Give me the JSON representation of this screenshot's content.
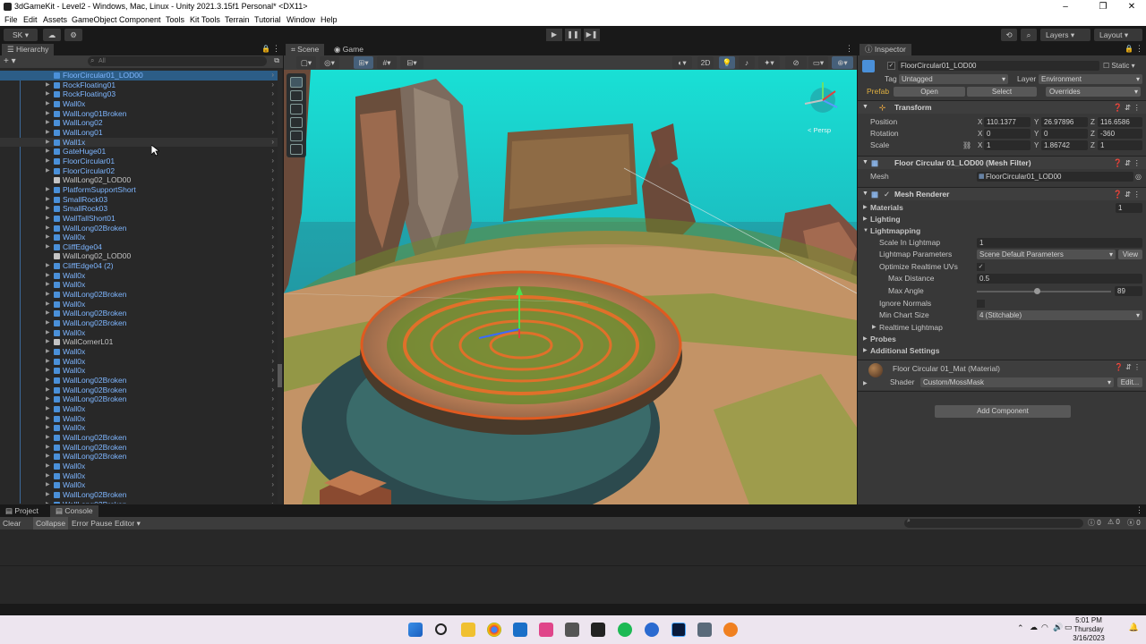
{
  "window": {
    "title": "3dGameKit - Level2 - Windows, Mac, Linux - Unity 2021.3.15f1 Personal* <DX11>",
    "minimize": "–",
    "maximize": "❐",
    "close": "✕"
  },
  "menu": [
    "File",
    "Edit",
    "Assets",
    "GameObject",
    "Component",
    "Tools",
    "Kit Tools",
    "Terrain",
    "Tutorial",
    "Window",
    "Help"
  ],
  "toolbar": {
    "account": "SK ▾",
    "play": "▶",
    "pause": "❚❚",
    "step": "▶❚",
    "layers": "Layers",
    "layout": "Layout"
  },
  "hierarchy": {
    "tab": "Hierarchy",
    "search_placeholder": "All",
    "items": [
      {
        "label": "FloorCircular01_LOD00",
        "color": "blue",
        "arrow": false,
        "selected": true
      },
      {
        "label": "RockFloating01",
        "color": "blue",
        "arrow": true
      },
      {
        "label": "RockFloating03",
        "color": "blue",
        "arrow": true
      },
      {
        "label": "Wall0x",
        "color": "blue",
        "arrow": true
      },
      {
        "label": "WallLong01Broken",
        "color": "blue",
        "arrow": true
      },
      {
        "label": "WallLong02",
        "color": "blue",
        "arrow": true
      },
      {
        "label": "WallLong01",
        "color": "blue",
        "arrow": true
      },
      {
        "label": "Wall1x",
        "color": "blue",
        "arrow": true,
        "hover": true
      },
      {
        "label": "GateHuge01",
        "color": "blue",
        "arrow": true
      },
      {
        "label": "FloorCircular01",
        "color": "blue",
        "arrow": true
      },
      {
        "label": "FloorCircular02",
        "color": "blue",
        "arrow": true
      },
      {
        "label": "WallLong02_LOD00",
        "color": "white",
        "arrow": false
      },
      {
        "label": "PlatformSupportShort",
        "color": "blue",
        "arrow": true
      },
      {
        "label": "SmallRock03",
        "color": "blue",
        "arrow": true
      },
      {
        "label": "SmallRock03",
        "color": "blue",
        "arrow": true
      },
      {
        "label": "WallTallShort01",
        "color": "blue",
        "arrow": true
      },
      {
        "label": "WallLong02Broken",
        "color": "blue",
        "arrow": true
      },
      {
        "label": "Wall0x",
        "color": "blue",
        "arrow": true
      },
      {
        "label": "CliffEdge04",
        "color": "blue",
        "arrow": true
      },
      {
        "label": "WallLong02_LOD00",
        "color": "white",
        "arrow": false
      },
      {
        "label": "CliffEdge04 (2)",
        "color": "blue",
        "arrow": true
      },
      {
        "label": "Wall0x",
        "color": "blue",
        "arrow": true
      },
      {
        "label": "Wall0x",
        "color": "blue",
        "arrow": true
      },
      {
        "label": "WallLong02Broken",
        "color": "blue",
        "arrow": true
      },
      {
        "label": "Wall0x",
        "color": "blue",
        "arrow": true
      },
      {
        "label": "WallLong02Broken",
        "color": "blue",
        "arrow": true
      },
      {
        "label": "WallLong02Broken",
        "color": "blue",
        "arrow": true
      },
      {
        "label": "Wall0x",
        "color": "blue",
        "arrow": true
      },
      {
        "label": "WallCornerL01",
        "color": "white",
        "arrow": true
      },
      {
        "label": "Wall0x",
        "color": "blue",
        "arrow": true
      },
      {
        "label": "Wall0x",
        "color": "blue",
        "arrow": true
      },
      {
        "label": "Wall0x",
        "color": "blue",
        "arrow": true
      },
      {
        "label": "WallLong02Broken",
        "color": "blue",
        "arrow": true
      },
      {
        "label": "WallLong02Broken",
        "color": "blue",
        "arrow": true
      },
      {
        "label": "WallLong02Broken",
        "color": "blue",
        "arrow": true
      },
      {
        "label": "Wall0x",
        "color": "blue",
        "arrow": true
      },
      {
        "label": "Wall0x",
        "color": "blue",
        "arrow": true
      },
      {
        "label": "Wall0x",
        "color": "blue",
        "arrow": true
      },
      {
        "label": "WallLong02Broken",
        "color": "blue",
        "arrow": true
      },
      {
        "label": "WallLong02Broken",
        "color": "blue",
        "arrow": true
      },
      {
        "label": "WallLong02Broken",
        "color": "blue",
        "arrow": true
      },
      {
        "label": "Wall0x",
        "color": "blue",
        "arrow": true
      },
      {
        "label": "Wall0x",
        "color": "blue",
        "arrow": true
      },
      {
        "label": "Wall0x",
        "color": "blue",
        "arrow": true
      },
      {
        "label": "WallLong02Broken",
        "color": "blue",
        "arrow": true
      },
      {
        "label": "WallLong02Broken",
        "color": "blue",
        "arrow": true
      }
    ]
  },
  "scene": {
    "tab_scene": "Scene",
    "tab_game": "Game",
    "mode_2d": "2D",
    "persp_label": "< Persp"
  },
  "inspector": {
    "tab": "Inspector",
    "object_name": "FloorCircular01_LOD00",
    "static_label": "Static",
    "tag_label": "Tag",
    "tag_value": "Untagged",
    "layer_label": "Layer",
    "layer_value": "Environment",
    "prefab_label": "Prefab",
    "prefab_open": "Open",
    "prefab_select": "Select",
    "prefab_overrides": "Overrides",
    "transform": {
      "title": "Transform",
      "position_label": "Position",
      "rotation_label": "Rotation",
      "scale_label": "Scale",
      "position": {
        "x": "110.1377",
        "y": "26.97896",
        "z": "116.6586"
      },
      "rotation": {
        "x": "0",
        "y": "0",
        "z": "-360"
      },
      "scale": {
        "x": "1",
        "y": "1.86742",
        "z": "1"
      }
    },
    "mesh_filter": {
      "title": "Floor Circular 01_LOD00 (Mesh Filter)",
      "mesh_label": "Mesh",
      "mesh_value": "FloorCircular01_LOD00"
    },
    "mesh_renderer": {
      "title": "Mesh Renderer",
      "materials_label": "Materials",
      "materials_count": "1",
      "lighting_label": "Lighting",
      "lightmapping_label": "Lightmapping",
      "scale_in_lightmap_label": "Scale In Lightmap",
      "scale_in_lightmap_value": "1",
      "lightmap_params_label": "Lightmap Parameters",
      "lightmap_params_value": "Scene Default Parameters",
      "view_button": "View",
      "optimize_label": "Optimize Realtime UVs",
      "max_distance_label": "Max Distance",
      "max_distance_value": "0.5",
      "max_angle_label": "Max Angle",
      "max_angle_value": "89",
      "max_angle_fraction": 0.45,
      "ignore_normals_label": "Ignore Normals",
      "min_chart_label": "Min Chart Size",
      "min_chart_value": "4 (Stitchable)",
      "realtime_lightmap_label": "Realtime Lightmap",
      "probes_label": "Probes",
      "additional_label": "Additional Settings"
    },
    "material": {
      "title": "Floor Circular 01_Mat (Material)",
      "shader_label": "Shader",
      "shader_value": "Custom/MossMask",
      "edit_button": "Edit..."
    },
    "add_component": "Add Component"
  },
  "bottom": {
    "tab_project": "Project",
    "tab_console": "Console",
    "clear": "Clear",
    "collapse": "Collapse",
    "error_pause": "Error Pause",
    "editor": "Editor",
    "count_info": "0",
    "count_warn": "0",
    "count_err": "0"
  },
  "taskbar": {
    "time": "5:01 PM",
    "day": "Thursday",
    "date": "3/16/2023"
  }
}
